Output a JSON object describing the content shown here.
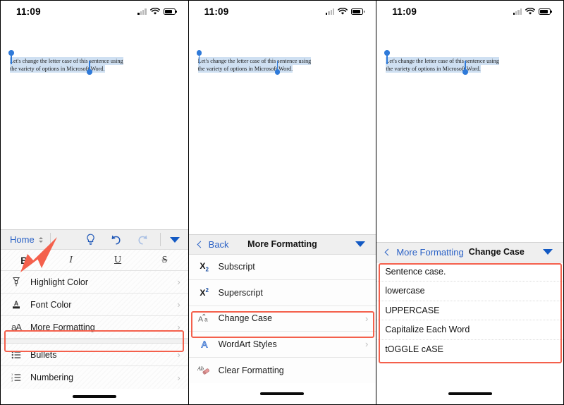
{
  "status": {
    "time": "11:09",
    "signal_icon": "cellular-signal-icon",
    "wifi_icon": "wifi-icon",
    "battery_icon": "battery-icon"
  },
  "document": {
    "text_line1": "Let's change the letter case of this sentence using",
    "text_line2": "the variety of options in Microsoft Word.",
    "selection_color": "#cfe0f2",
    "handle_color": "#2f7ad9"
  },
  "colors": {
    "accent_blue": "#2b62c6",
    "highlight_red": "#f4604c",
    "ribbon_grey": "#efefef"
  },
  "panel1": {
    "ribbon": {
      "tab_label": "Home",
      "stepper_icon": "up-down-chevron-icon",
      "tellme_icon": "lightbulb-icon",
      "undo_icon": "undo-icon",
      "redo_icon": "redo-icon",
      "collapse_icon": "caret-down-icon"
    },
    "format_row": [
      {
        "label": "B",
        "name": "bold-button"
      },
      {
        "label": "I",
        "name": "italic-button"
      },
      {
        "label": "U",
        "name": "underline-button"
      },
      {
        "label": "S",
        "name": "strikethrough-button"
      }
    ],
    "menu_items": [
      {
        "label": "Highlight Color",
        "icon": "highlighter-icon",
        "chevron": "›"
      },
      {
        "label": "Font Color",
        "icon": "font-color-icon",
        "chevron": "›"
      },
      {
        "label": "More Formatting",
        "icon": "aa-format-icon",
        "chevron": "›",
        "highlighted": true
      },
      {
        "label": "Bullets",
        "icon": "bullet-list-icon",
        "chevron": "›"
      },
      {
        "label": "Numbering",
        "icon": "numbered-list-icon",
        "chevron": "›"
      }
    ]
  },
  "panel2": {
    "ribbon": {
      "back_label": "Back",
      "title": "More Formatting",
      "back_icon": "back-chevron-icon",
      "collapse_icon": "caret-down-icon"
    },
    "menu_items": [
      {
        "label": "Subscript",
        "icon": "subscript-icon",
        "chevron": ""
      },
      {
        "label": "Superscript",
        "icon": "superscript-icon",
        "chevron": ""
      },
      {
        "label": "Change Case",
        "icon": "change-case-icon",
        "chevron": "›",
        "highlighted": true
      },
      {
        "label": "WordArt Styles",
        "icon": "wordart-icon",
        "chevron": "›"
      },
      {
        "label": "Clear Formatting",
        "icon": "clear-formatting-icon",
        "chevron": ""
      }
    ]
  },
  "panel3": {
    "ribbon": {
      "back_label": "More Formatting",
      "title": "Change Case",
      "back_icon": "back-chevron-icon",
      "collapse_icon": "caret-down-icon"
    },
    "options": [
      {
        "label": "Sentence case."
      },
      {
        "label": "lowercase"
      },
      {
        "label": "UPPERCASE"
      },
      {
        "label": "Capitalize Each Word"
      },
      {
        "label": "tOGGLE cASE"
      }
    ]
  },
  "annotations": {
    "arrow_color": "#f4604c",
    "arrow_target": "Home"
  }
}
